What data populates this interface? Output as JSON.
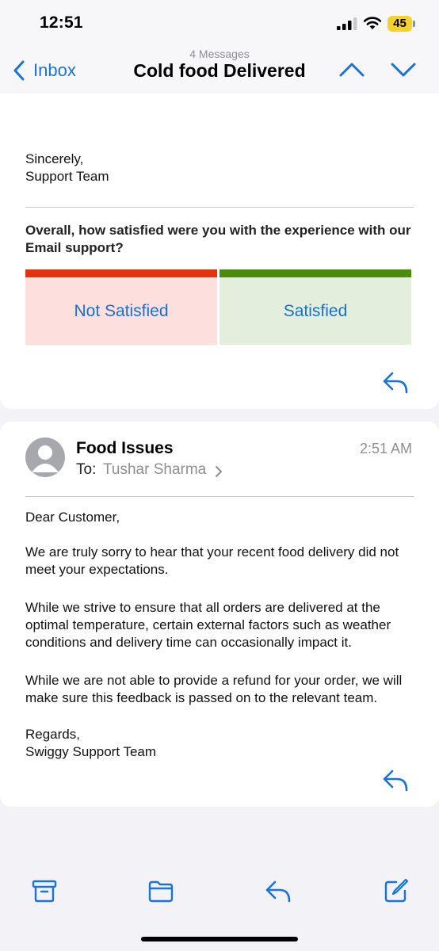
{
  "status": {
    "time": "12:51",
    "battery": "45"
  },
  "nav": {
    "back_label": "Inbox",
    "message_count": "4 Messages",
    "title": "Cold food Delivered"
  },
  "message1": {
    "sign_off": "Sincerely,",
    "signature": "Support Team",
    "survey": {
      "question": "Overall, how satisfied were you with the experience with our Email support?",
      "options": [
        "Not Satisfied",
        "Satisfied"
      ],
      "colors": {
        "not_satisfied_bar": "#e0330f",
        "satisfied_bar": "#4a8a0c"
      }
    }
  },
  "message2": {
    "sender": "Food Issues",
    "time": "2:51 AM",
    "to_label": "To:",
    "to_name": "Tushar Sharma",
    "greeting": "Dear Customer,",
    "paragraphs": [
      "We are truly sorry to hear that your recent food delivery did not meet your expectations.",
      "While we strive to ensure that all orders are delivered at the optimal temperature, certain external factors such as weather conditions and delivery time can occasionally impact it.",
      "While we are not able to provide a refund for your order, we will make sure this feedback is passed on to the relevant team."
    ],
    "sign_off": "Regards,",
    "signature": "Swiggy Support Team"
  },
  "toolbar": {
    "icons": [
      "archive-icon",
      "folder-icon",
      "reply-icon",
      "compose-icon"
    ]
  },
  "accent_color": "#1a73d6"
}
